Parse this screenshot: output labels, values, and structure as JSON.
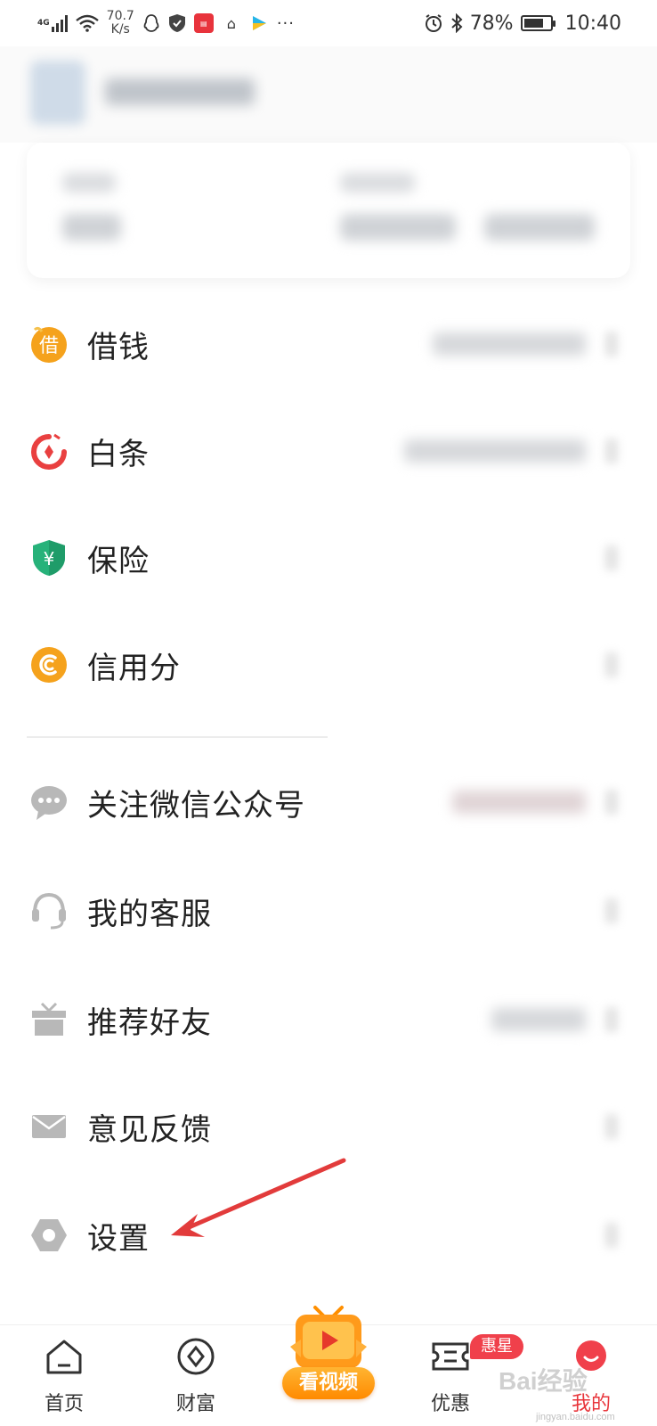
{
  "status_bar": {
    "network": "4G",
    "speed_value": "70.7",
    "speed_unit": "K/s",
    "battery": "78%",
    "time": "10:40",
    "more": "···",
    "app_icons": [
      "qq-icon",
      "shield-icon",
      "news-app-icon",
      "photo-app-icon",
      "video-app-icon"
    ],
    "right_icons": [
      "alarm-icon",
      "bluetooth-icon",
      "battery-icon"
    ]
  },
  "menu": {
    "items": [
      {
        "label": "借钱",
        "icon": "borrow-icon",
        "icon_text": "借",
        "color": "#f5a21c"
      },
      {
        "label": "白条",
        "icon": "baitiao-icon",
        "color": "#e94040"
      },
      {
        "label": "保险",
        "icon": "insurance-shield-icon",
        "icon_text": "¥",
        "color": "#27b27a"
      },
      {
        "label": "信用分",
        "icon": "credit-score-icon",
        "color": "#f5a21c"
      },
      {
        "label": "关注微信公众号",
        "icon": "wechat-chat-icon",
        "color": "#b8b8b8"
      },
      {
        "label": "我的客服",
        "icon": "headset-icon",
        "color": "#b8b8b8"
      },
      {
        "label": "推荐好友",
        "icon": "gift-icon",
        "color": "#b8b8b8"
      },
      {
        "label": "意见反馈",
        "icon": "mail-icon",
        "color": "#b8b8b8"
      },
      {
        "label": "设置",
        "icon": "settings-hex-icon",
        "color": "#b8b8b8"
      }
    ]
  },
  "bottom_nav": {
    "items": [
      {
        "label": "首页",
        "icon": "home-icon"
      },
      {
        "label": "财富",
        "icon": "wealth-icon"
      },
      {
        "label": "看视频",
        "icon": "tv-play-icon"
      },
      {
        "label": "优惠",
        "icon": "coupon-icon"
      },
      {
        "label": "我的",
        "icon": "profile-icon",
        "active": true
      }
    ],
    "badge": "惠星"
  },
  "watermark": {
    "text": "Bai经验",
    "sub": "jingyan.baidu.com"
  },
  "colors": {
    "accent": "#e8353b",
    "annotation": "#e23b3b"
  }
}
